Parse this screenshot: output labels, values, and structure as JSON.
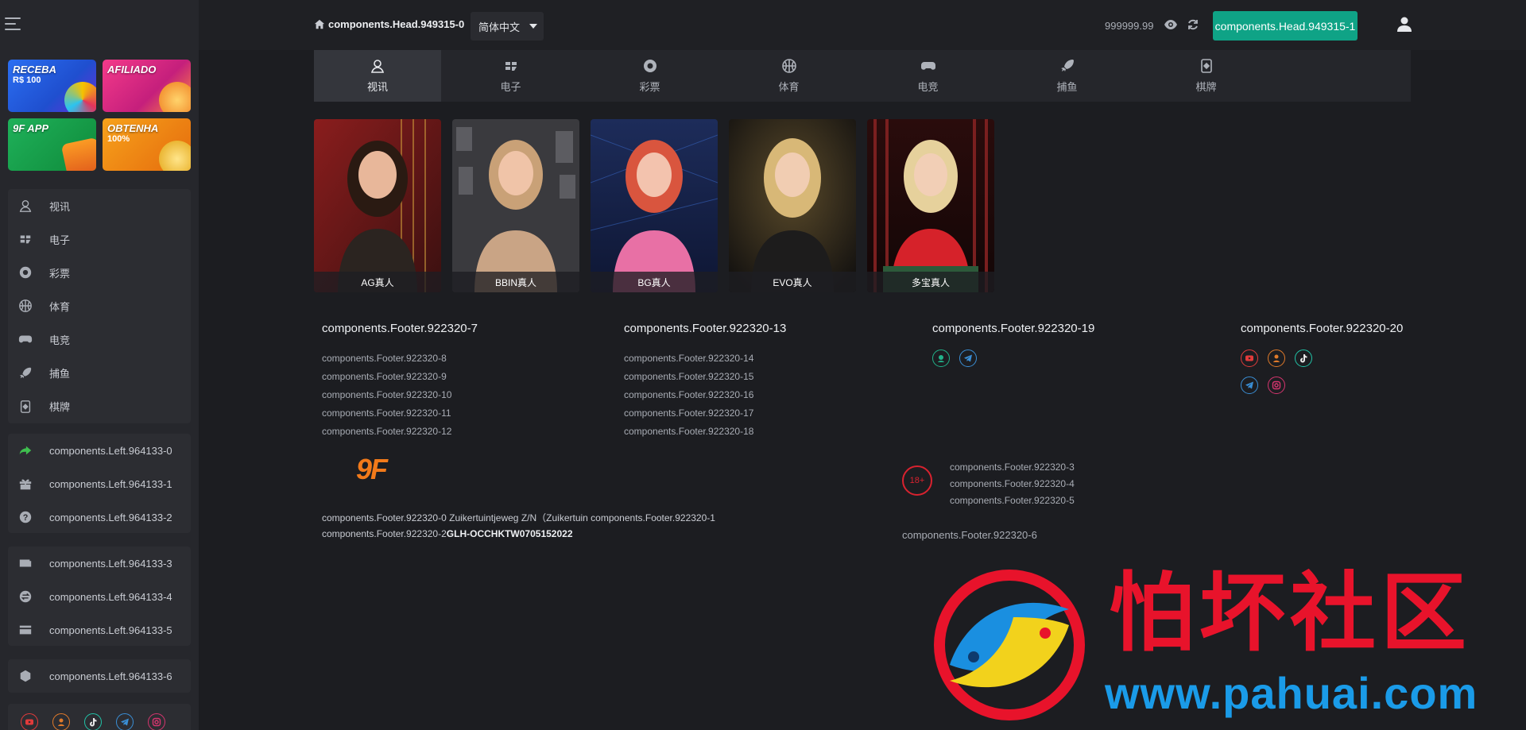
{
  "header": {
    "home_label": "components.Head.949315-0",
    "language": "简体中文",
    "balance": "999999.99",
    "action_button": "components.Head.949315-1"
  },
  "promos": [
    {
      "title": "RECEBA",
      "subtitle": "R$ 100"
    },
    {
      "title": "AFILIADO",
      "subtitle": ""
    },
    {
      "title": "9F APP",
      "subtitle": ""
    },
    {
      "title": "OBTENHA",
      "subtitle": "100%"
    }
  ],
  "sidebar": {
    "games": [
      {
        "label": "视讯",
        "icon": "live-dealer-icon"
      },
      {
        "label": "电子",
        "icon": "slots-icon"
      },
      {
        "label": "彩票",
        "icon": "lottery-icon"
      },
      {
        "label": "体育",
        "icon": "sports-icon"
      },
      {
        "label": "电竞",
        "icon": "esports-icon"
      },
      {
        "label": "捕鱼",
        "icon": "fishing-icon"
      },
      {
        "label": "棋牌",
        "icon": "cards-icon"
      }
    ],
    "group2": [
      {
        "label": "components.Left.964133-0",
        "icon": "share-icon"
      },
      {
        "label": "components.Left.964133-1",
        "icon": "gift-icon"
      },
      {
        "label": "components.Left.964133-2",
        "icon": "help-icon"
      }
    ],
    "group3": [
      {
        "label": "components.Left.964133-3",
        "icon": "wallet-icon"
      },
      {
        "label": "components.Left.964133-4",
        "icon": "exchange-icon"
      },
      {
        "label": "components.Left.964133-5",
        "icon": "card-icon"
      }
    ],
    "group4": [
      {
        "label": "components.Left.964133-6",
        "icon": "cube-icon"
      }
    ]
  },
  "tabs": [
    {
      "label": "视讯",
      "icon": "live-dealer-icon",
      "active": true
    },
    {
      "label": "电子",
      "icon": "slots-icon"
    },
    {
      "label": "彩票",
      "icon": "lottery-icon"
    },
    {
      "label": "体育",
      "icon": "sports-icon"
    },
    {
      "label": "电竞",
      "icon": "esports-icon"
    },
    {
      "label": "捕鱼",
      "icon": "fishing-icon"
    },
    {
      "label": "棋牌",
      "icon": "cards-icon"
    }
  ],
  "cards": [
    {
      "label": "AG真人"
    },
    {
      "label": "BBIN真人"
    },
    {
      "label": "BG真人"
    },
    {
      "label": "EVO真人"
    },
    {
      "label": "多宝真人"
    }
  ],
  "footer": {
    "col1": {
      "title": "components.Footer.922320-7",
      "links": [
        "components.Footer.922320-8",
        "components.Footer.922320-9",
        "components.Footer.922320-10",
        "components.Footer.922320-11",
        "components.Footer.922320-12"
      ]
    },
    "col2": {
      "title": "components.Footer.922320-13",
      "links": [
        "components.Footer.922320-14",
        "components.Footer.922320-15",
        "components.Footer.922320-16",
        "components.Footer.922320-17",
        "components.Footer.922320-18"
      ]
    },
    "col3": {
      "title": "components.Footer.922320-19"
    },
    "col4": {
      "title": "components.Footer.922320-20"
    },
    "brand": "9F",
    "address_line1": "components.Footer.922320-0 Zuikertuintjeweg Z/N（Zuikertuin components.Footer.922320-1",
    "address_line2_prefix": "components.Footer.922320-2",
    "license": "GLH-OCCHKTW0705152022",
    "age_badge": "18+",
    "age_links": [
      "components.Footer.922320-3",
      "components.Footer.922320-4",
      "components.Footer.922320-5"
    ],
    "note": "components.Footer.922320-6"
  },
  "watermark": {
    "text": "怕坏社区",
    "url": "www.pahuai.com"
  },
  "colors": {
    "accent": "#0fa386",
    "sidebar_bg": "#26272c",
    "page_bg": "#1c1d21"
  }
}
